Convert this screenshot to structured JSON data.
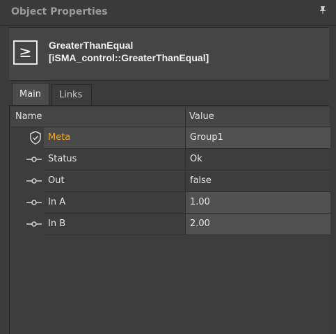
{
  "panel": {
    "title": "Object Properties",
    "pin_icon": "pin-icon"
  },
  "object": {
    "name": "GreaterThanEqual",
    "type": "[iSMA_control::GreaterThanEqual]",
    "icon": "greater-than-equal-icon",
    "icon_glyph": "≥"
  },
  "tabs": [
    {
      "label": "Main",
      "active": true
    },
    {
      "label": "Links",
      "active": false
    }
  ],
  "table": {
    "headers": {
      "name": "Name",
      "value": "Value"
    },
    "rows": [
      {
        "name": "Meta",
        "value": "Group1",
        "icon": "shield-icon",
        "highlight": true,
        "editable": true
      },
      {
        "name": "Status",
        "value": "Ok",
        "icon": "slot-icon",
        "editable": false
      },
      {
        "name": "Out",
        "value": "false",
        "icon": "slot-icon",
        "editable": false
      },
      {
        "name": "In A",
        "value": "1.00",
        "icon": "slot-icon",
        "editable": true
      },
      {
        "name": "In B",
        "value": "2.00",
        "icon": "slot-icon",
        "editable": true
      }
    ]
  },
  "colors": {
    "accent": "#f0a42a",
    "editable_value_bg": "#505050",
    "readonly_value_bg": "#3d3d3d",
    "meta_name_bg": "#4a4a4a"
  }
}
